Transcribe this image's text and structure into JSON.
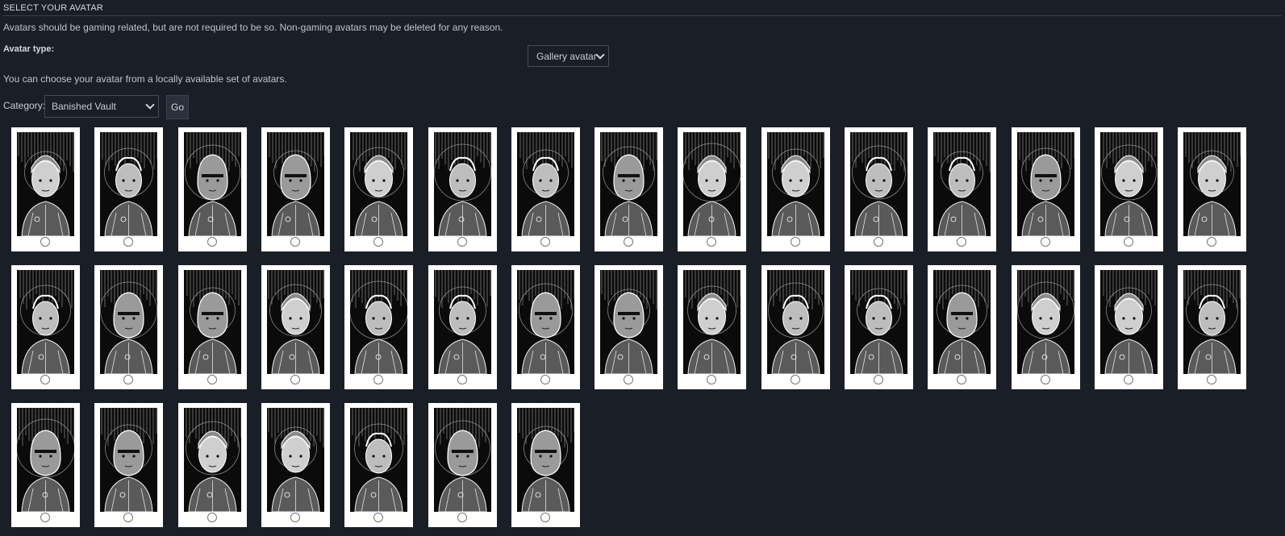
{
  "header": {
    "title": "SELECT YOUR AVATAR"
  },
  "description": "Avatars should be gaming related, but are not required to be so. Non-gaming avatars may be deleted for any reason.",
  "avatar_type": {
    "label": "Avatar type:",
    "selected": "Gallery avatar"
  },
  "local_info": "You can choose your avatar from a locally available set of avatars.",
  "category": {
    "label": "Category:",
    "selected": "Banished Vault",
    "go_label": "Go"
  },
  "gallery": {
    "count": 37,
    "columns": 15,
    "selected_index": null,
    "icons": [
      "portrait-icon",
      "radio-icon"
    ],
    "colors": {
      "background": "#1a1e27",
      "tile": "#ffffff",
      "portrait": "#0b0b0b"
    }
  }
}
